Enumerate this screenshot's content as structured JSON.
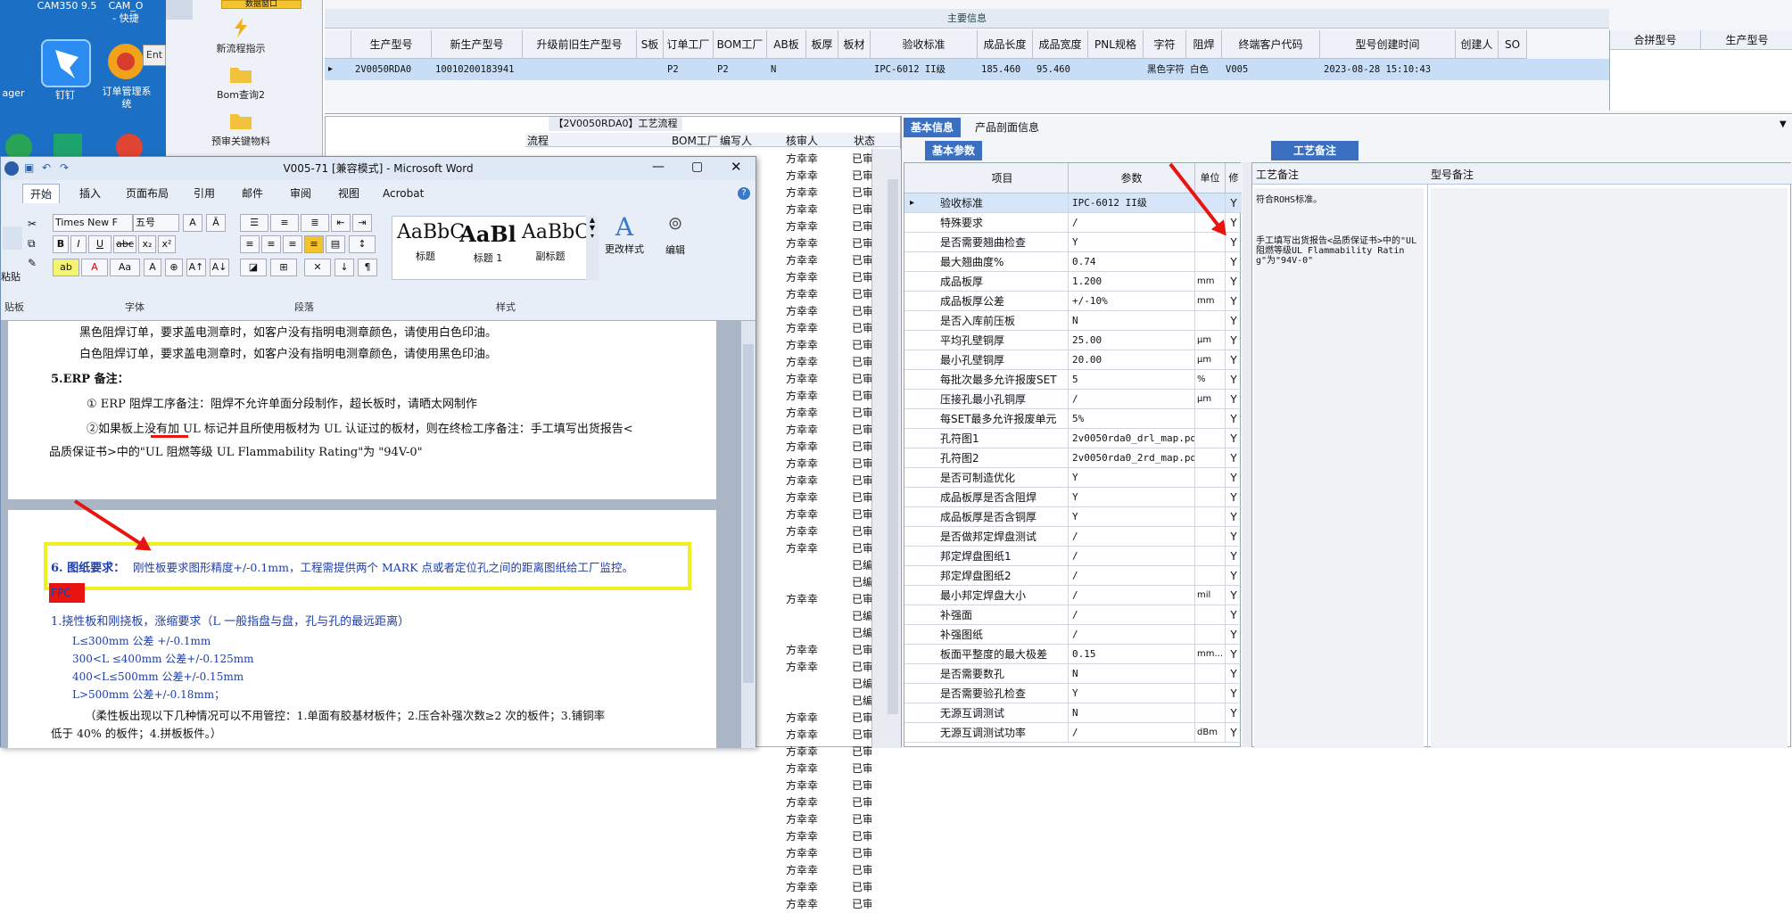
{
  "desktop": {
    "top_labels": [
      "CAM350 9.5",
      "CAM_O",
      "- 快捷"
    ],
    "left_label": "ager",
    "app1_label": "钉钉",
    "app2_label": "订单管理系统"
  },
  "nav": {
    "tab": "数据窗口",
    "items": [
      "新流程指示",
      "Bom查询2",
      "预审关键物料"
    ]
  },
  "main_info": {
    "title": "主要信息",
    "headers": [
      "生产型号",
      "新生产型号",
      "升级前旧生产型号",
      "S板",
      "订单工厂",
      "BOM工厂",
      "AB板",
      "板厚",
      "板材",
      "验收标准",
      "成品长度",
      "成品宽度",
      "PNL规格",
      "字符",
      "阻焊",
      "终端客户代码",
      "型号创建时间",
      "创建人",
      "SO"
    ],
    "row": [
      "2V0050RDA0",
      "10010200183941",
      "",
      "",
      "P2",
      "P2",
      "N",
      "",
      "",
      "IPC-6012 II级",
      "185.460",
      "95.460",
      "",
      "黑色字符",
      "白色",
      "V005",
      "2023-08-28 15:10:43",
      "",
      ""
    ],
    "right_headers": [
      "合拼型号",
      "生产型号"
    ]
  },
  "process": {
    "title": "【2V0050RDA0】工艺流程",
    "headers": [
      "流程",
      "BOM工厂",
      "编写人",
      "核审人",
      "状态"
    ],
    "reviewer": "方幸幸",
    "status_approved": "已审核",
    "status_written": "已编写",
    "rows": [
      [
        "方幸幸",
        "已审核"
      ],
      [
        "方幸幸",
        "已审核"
      ],
      [
        "方幸幸",
        "已审核"
      ],
      [
        "方幸幸",
        "已审核"
      ],
      [
        "方幸幸",
        "已审核"
      ],
      [
        "方幸幸",
        "已审核"
      ],
      [
        "方幸幸",
        "已审核"
      ],
      [
        "方幸幸",
        "已审核"
      ],
      [
        "方幸幸",
        "已审核"
      ],
      [
        "方幸幸",
        "已审核"
      ],
      [
        "方幸幸",
        "已审核"
      ],
      [
        "方幸幸",
        "已审核"
      ],
      [
        "方幸幸",
        "已审核"
      ],
      [
        "方幸幸",
        "已审核"
      ],
      [
        "方幸幸",
        "已审核"
      ],
      [
        "方幸幸",
        "已审核"
      ],
      [
        "方幸幸",
        "已审核"
      ],
      [
        "方幸幸",
        "已审核"
      ],
      [
        "方幸幸",
        "已审核"
      ],
      [
        "方幸幸",
        "已审核"
      ],
      [
        "方幸幸",
        "已审核"
      ],
      [
        "方幸幸",
        "已审核"
      ],
      [
        "方幸幸",
        "已审核"
      ],
      [
        "方幸幸",
        "已审核"
      ],
      [
        "",
        "已编写"
      ],
      [
        "",
        "已编写"
      ],
      [
        "方幸幸",
        "已审核"
      ],
      [
        "",
        "已编写"
      ],
      [
        "",
        "已编写"
      ],
      [
        "方幸幸",
        "已审核"
      ],
      [
        "方幸幸",
        "已审核"
      ],
      [
        "",
        "已编写"
      ],
      [
        "",
        "已编写"
      ],
      [
        "方幸幸",
        "已审核"
      ],
      [
        "方幸幸",
        "已审核"
      ],
      [
        "方幸幸",
        "已审核"
      ],
      [
        "方幸幸",
        "已审核"
      ],
      [
        "方幸幸",
        "已审核"
      ],
      [
        "方幸幸",
        "已审核"
      ],
      [
        "方幸幸",
        "已审核"
      ],
      [
        "方幸幸",
        "已审核"
      ],
      [
        "方幸幸",
        "已审核"
      ],
      [
        "方幸幸",
        "已审核"
      ],
      [
        "方幸幸",
        "已审核"
      ],
      [
        "方幸幸",
        "已审核"
      ]
    ]
  },
  "detail": {
    "tabs": [
      "基本信息",
      "产品剖面信息"
    ],
    "subtab_basic": "基本参数",
    "subtab_craft": "工艺备注",
    "col_item": "项目",
    "col_param": "参数",
    "col_unit": "单位",
    "col_flag": "修",
    "craft_col1": "工艺备注",
    "craft_col2": "型号备注",
    "craft_text1": "符合ROHS标准。",
    "craft_text2": "手工填写出货报告<品质保证书>中的\"UL阻燃等级UL Flammability Rating\"为\"94V-0\"",
    "params": [
      [
        "验收标准",
        "IPC-6012 II级",
        "",
        "Y"
      ],
      [
        "特殊要求",
        "/",
        "",
        "Y"
      ],
      [
        "是否需要翘曲检查",
        "Y",
        "",
        "Y"
      ],
      [
        "最大翘曲度%",
        "0.74",
        "",
        "Y"
      ],
      [
        "成品板厚",
        "1.200",
        "mm",
        "Y"
      ],
      [
        "成品板厚公差",
        "+/-10%",
        "mm",
        "Y"
      ],
      [
        "是否入库前压板",
        "N",
        "",
        "Y"
      ],
      [
        "平均孔壁铜厚",
        "25.00",
        "μm",
        "Y"
      ],
      [
        "最小孔壁铜厚",
        "20.00",
        "μm",
        "Y"
      ],
      [
        "每批次最多允许报废SET",
        "5",
        "%",
        "Y"
      ],
      [
        "压接孔最小孔铜厚",
        "/",
        "μm",
        "Y"
      ],
      [
        "每SET最多允许报废单元",
        "5%",
        "",
        "Y"
      ],
      [
        "孔符图1",
        "2v0050rda0_drl_map.pdf",
        "",
        "Y"
      ],
      [
        "孔符图2",
        "2v0050rda0_2rd_map.pdf",
        "",
        "Y"
      ],
      [
        "是否可制造优化",
        "Y",
        "",
        "Y"
      ],
      [
        "成品板厚是否含阻焊",
        "Y",
        "",
        "Y"
      ],
      [
        "成品板厚是否含铜厚",
        "Y",
        "",
        "Y"
      ],
      [
        "是否做邦定焊盘测试",
        "/",
        "",
        "Y"
      ],
      [
        "邦定焊盘图纸1",
        "/",
        "",
        "Y"
      ],
      [
        "邦定焊盘图纸2",
        "/",
        "",
        "Y"
      ],
      [
        "最小邦定焊盘大小",
        "/",
        "mil",
        "Y"
      ],
      [
        "补强面",
        "/",
        "",
        "Y"
      ],
      [
        "补强图纸",
        "/",
        "",
        "Y"
      ],
      [
        "板面平整度的最大极差",
        "0.15",
        "mm...",
        "Y"
      ],
      [
        "是否需要数孔",
        "N",
        "",
        "Y"
      ],
      [
        "是否需要验孔检查",
        "Y",
        "",
        "Y"
      ],
      [
        "无源互调测试",
        "N",
        "",
        "Y"
      ],
      [
        "无源互调测试功率",
        "/",
        "dBm",
        "Y"
      ]
    ]
  },
  "word": {
    "title": "V005-71 [兼容模式] - Microsoft Word",
    "tabs": [
      "开始",
      "插入",
      "页面布局",
      "引用",
      "邮件",
      "审阅",
      "视图",
      "Acrobat"
    ],
    "font_name": "Times New F",
    "font_size": "五号",
    "styles": [
      {
        "preview": "AaBbC",
        "label": "标题"
      },
      {
        "preview": "AaBl",
        "label": "标题 1"
      },
      {
        "preview": "AaBbC",
        "label": "副标题"
      }
    ],
    "change_style": "更改样式",
    "edit": "编辑",
    "group_labels": [
      "贴板",
      "字体",
      "段落",
      "样式"
    ],
    "paste": "粘贴",
    "doc": {
      "l1": "黑色阻焊订单，要求盖电测章时，如客户没有指明电测章颜色，请使用白色印油。",
      "l2": "白色阻焊订单，要求盖电测章时，如客户没有指明电测章颜色，请使用黑色印油。",
      "l3": "5.ERP 备注：",
      "l4": "① ERP 阻焊工序备注：阻焊不允许单面分段制作，超长板时，请晒太网制作",
      "l5": "②如果板上没有加 UL 标记并且所使用板材为 UL 认证过的板材，则在终检工序备注：手工填写出货报告<",
      "l6": "品质保证书>中的\"UL 阻燃等级 UL Flammability Rating\"为 \"94V-0\"",
      "l7_label": "6. 图纸要求：",
      "l7_text": "刚性板要求图形精度+/-0.1mm，工程需提供两个 MARK 点或者定位孔之间的距离图纸给工厂监控。",
      "fpc": "FPC",
      "l8": "1.挠性板和刚挠板，涨缩要求（L 一般指盘与盘，孔与孔的最远距离）",
      "l9": "L≤300mm 公差 +/-0.1mm",
      "l10": "300<L ≤400mm 公差+/-0.125mm",
      "l11": "400<L≤500mm 公差+/-0.15mm",
      "l12": "L>500mm 公差+/-0.18mm；",
      "l13": "（柔性板出现以下几种情况可以不用管控：1.单面有胶基材板件；2.压合补强次数≥2 次的板件；3.铺铜率",
      "l14": "低于 40% 的板件；4.拼板板件。）"
    }
  },
  "colors": {
    "accent_blue": "#1b6fc4",
    "highlight_yellow": "#f0f020",
    "arrow_red": "#e8140f",
    "fpc_red": "#e8140f"
  }
}
